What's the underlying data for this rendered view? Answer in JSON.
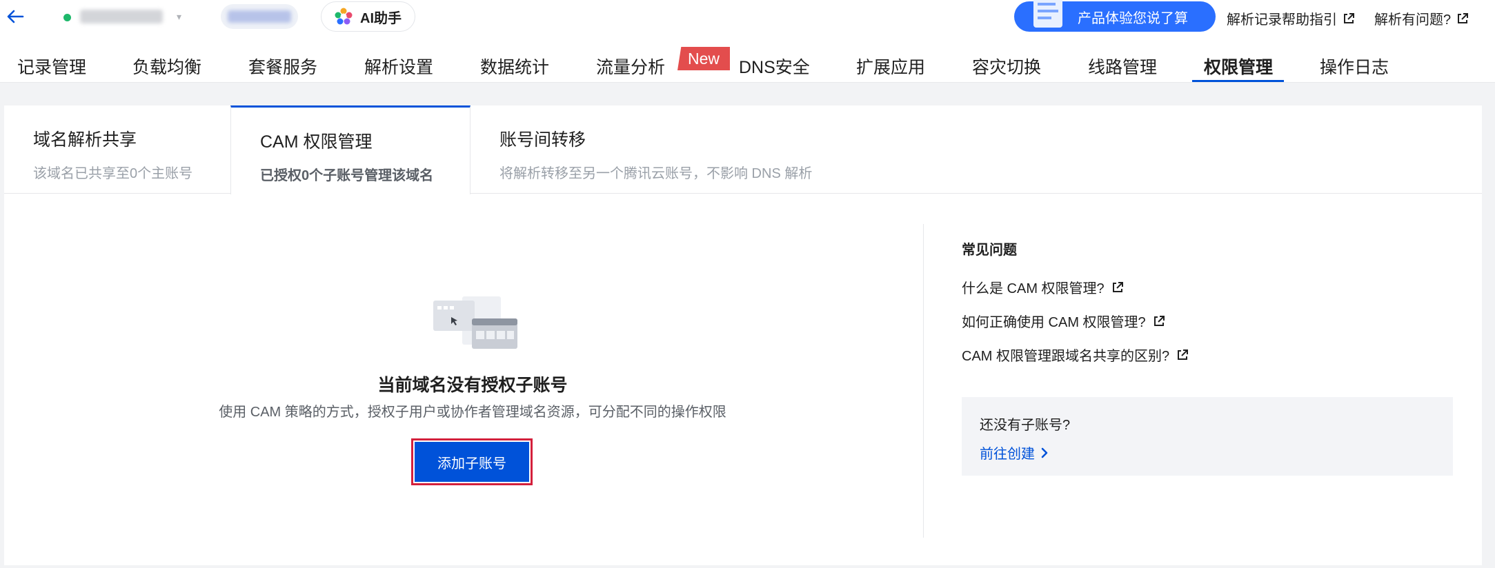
{
  "header": {
    "ai_label": "AI助手",
    "feedback_label": "产品体验您说了算",
    "help_link": "解析记录帮助指引",
    "issue_link": "解析有问题?"
  },
  "nav": {
    "items": [
      {
        "label": "记录管理"
      },
      {
        "label": "负载均衡"
      },
      {
        "label": "套餐服务"
      },
      {
        "label": "解析设置"
      },
      {
        "label": "数据统计"
      },
      {
        "label": "流量分析"
      },
      {
        "label": "DNS安全"
      },
      {
        "label": "扩展应用"
      },
      {
        "label": "容灾切换"
      },
      {
        "label": "线路管理"
      },
      {
        "label": "权限管理"
      },
      {
        "label": "操作日志"
      }
    ],
    "active": "权限管理",
    "new_badge": "New"
  },
  "subtabs": [
    {
      "title": "域名解析共享",
      "desc": "该域名已共享至0个主账号"
    },
    {
      "title": "CAM 权限管理",
      "desc": "已授权0个子账号管理该域名"
    },
    {
      "title": "账号间转移",
      "desc": "将解析转移至另一个腾讯云账号，不影响 DNS 解析"
    }
  ],
  "empty_state": {
    "title": "当前域名没有授权子账号",
    "description": "使用 CAM 策略的方式，授权子用户或协作者管理域名资源，可分配不同的操作权限",
    "button": "添加子账号"
  },
  "faq": {
    "title": "常见问题",
    "links": [
      {
        "label": "什么是 CAM 权限管理?"
      },
      {
        "label": "如何正确使用 CAM 权限管理?"
      },
      {
        "label": "CAM 权限管理跟域名共享的区别?"
      }
    ]
  },
  "create": {
    "question": "还没有子账号?",
    "link": "前往创建"
  },
  "colors": {
    "accent": "#0052d9",
    "feedback_bg": "#2a6fff",
    "new_badge": "#e34d4d",
    "status_ok": "#1eb86b",
    "highlight_border": "#d3203c"
  }
}
